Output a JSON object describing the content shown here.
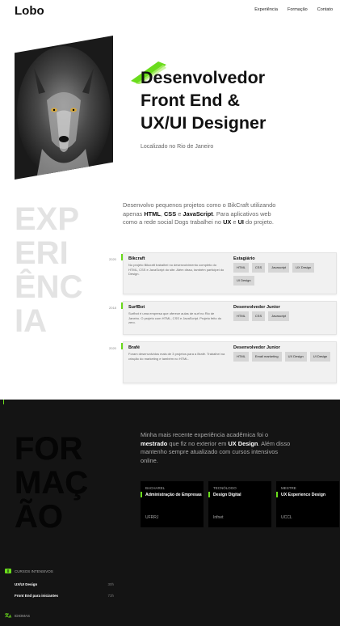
{
  "header": {
    "logo": "Lobo",
    "nav": [
      "Experiência",
      "Formação",
      "Contato"
    ]
  },
  "hero": {
    "title_lines": [
      "Desenvolvedor",
      "Front End &",
      "UX/UI Designer"
    ],
    "location": "Localizado no Rio de Janeiro"
  },
  "experience": {
    "big_word": [
      "EXP",
      "ERI",
      "ÊNC",
      "IA"
    ],
    "intro_parts": [
      "Desenvolvo pequenos projetos como o BikCraft utilizando apenas ",
      "HTML",
      ", ",
      "CSS",
      " e ",
      "JavaScript",
      ". Para aplicativos web como a rede social Dogs trabalhei no ",
      "UX",
      " e ",
      "UI",
      " do projeto."
    ],
    "jobs": [
      {
        "year": "2020",
        "name": "Bikcraft",
        "description": "No projeto Bikcraft trabalhei no desenvolvimento completo do HTML, CSS e JavaScript do site. Além disso, também participei do Design.",
        "role": "Estagiário",
        "tags": [
          "HTML",
          "CSS",
          "Javascript",
          "UX Design",
          "UI Design"
        ]
      },
      {
        "year": "2018",
        "name": "SurfBot",
        "description": "Surfbot é uma empresa que oferece aulas de surf no Rio de Janeiro. O projeto com HTML, CSS e JavaScript. Projeto feito do zero.",
        "role": "Desenvolvedor Junior",
        "tags": [
          "HTML",
          "CSS",
          "Javascript"
        ]
      },
      {
        "year": "2020",
        "name": "Brafé",
        "description": "Foram desenvolvidos mais de 3 projetos para a Brafé. Trabalhei na criação do marketing e também no HTML.",
        "role": "Desenvolvedor Junior",
        "tags": [
          "HTML",
          "Email marketing",
          "UX Design",
          "UI Design"
        ]
      }
    ]
  },
  "formacao": {
    "big_word": [
      "FOR",
      "MAÇ",
      "ÃO"
    ],
    "intro_parts": [
      "Minha mais recente experiência acadêmica foi o ",
      "mestrado",
      " que fiz no exterior em ",
      "UX Design",
      ". Além disso mantenho sempre atualizado com cursos intensivos online."
    ],
    "cards": [
      {
        "level": "BACHAREL",
        "title": "Administração de Empresas",
        "institution": "UFRRJ"
      },
      {
        "level": "TECNÓLOGO",
        "title": "Design Digital",
        "institution": "Infnet"
      },
      {
        "level": "MESTRE",
        "title": "UX Experience Design",
        "institution": "UCCL"
      }
    ],
    "courses_label": "CURSOS INTENSIVOS",
    "courses": [
      {
        "name": "UX/UI Design",
        "hours": "30h"
      },
      {
        "name": "Front End para iniciantes",
        "hours": "73h"
      }
    ],
    "languages_label": "IDIOMAS"
  },
  "colors": {
    "accent": "#6adc1c",
    "dark_bg": "#141414",
    "big_word_light": "#e3e3e3"
  }
}
